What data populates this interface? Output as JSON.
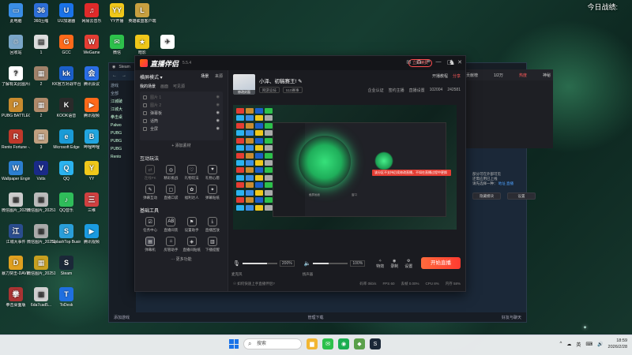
{
  "desktop": {
    "top_right_text": "今日战绩:",
    "col1": [
      {
        "label": "此电脑",
        "color": "#3a8ee6",
        "glyph": "▭"
      },
      {
        "label": "回收站",
        "color": "#7aa6c8",
        "glyph": "♲"
      },
      {
        "label": "了解有关此图片的信息",
        "color": "#ffffff",
        "glyph": "?"
      },
      {
        "label": "PUBG BATTLEGR...",
        "color": "#c98b2f",
        "glyph": "P"
      },
      {
        "label": "Rento Fortune -...",
        "color": "#c0392b",
        "glyph": "R"
      },
      {
        "label": "Wallpaper Engine:...",
        "color": "#2c7fd1",
        "glyph": "W"
      },
      {
        "label": "微信图片_2025121...",
        "color": "#cccccc",
        "glyph": "▦"
      },
      {
        "label": "江城大事件",
        "color": "#2a4d8f",
        "glyph": "江"
      },
      {
        "label": "暴力突击-DAVE T...",
        "color": "#e0a020",
        "glyph": "D"
      },
      {
        "label": "拳击桌面版",
        "color": "#aa3333",
        "glyph": "拳"
      }
    ],
    "col2": [
      {
        "label": "360压缩",
        "color": "#2d6fd8",
        "glyph": "36"
      },
      {
        "label": "1",
        "color": "#dddddd",
        "glyph": "▤"
      },
      {
        "label": "2",
        "color": "#a0826a",
        "glyph": "▦"
      },
      {
        "label": "2",
        "color": "#b08a6a",
        "glyph": "▦"
      },
      {
        "label": "3",
        "color": "#c0a080",
        "glyph": "▦"
      },
      {
        "label": "Vstts",
        "color": "#1a2a88",
        "glyph": "V"
      },
      {
        "label": "微信图片_2025121...",
        "color": "#bbbbbb",
        "glyph": "▦"
      },
      {
        "label": "微信图片_2025121...",
        "color": "#aaaaaa",
        "glyph": "▦"
      },
      {
        "label": "微信图片_2025121...",
        "color": "#c8a020",
        "glyph": "▦"
      },
      {
        "label": "6da7cad5...",
        "color": "#d0d0d0",
        "glyph": "▦"
      }
    ],
    "col3": [
      {
        "label": "UU加速器",
        "color": "#1a73e8",
        "glyph": "U"
      },
      {
        "label": "GCC",
        "color": "#ff6a1a",
        "glyph": "G"
      },
      {
        "label": "KK官方对战平台",
        "color": "#1b5fc9",
        "glyph": "kk"
      },
      {
        "label": "KOOK语音",
        "color": "#2a2a2a",
        "glyph": "K"
      },
      {
        "label": "Microsoft Edge",
        "color": "#1a9bd7",
        "glyph": "e"
      },
      {
        "label": "QQ",
        "color": "#2bb3f0",
        "glyph": "Q"
      },
      {
        "label": "QQ音乐",
        "color": "#2fbd5a",
        "glyph": "♪"
      },
      {
        "label": "SplashTop Business",
        "color": "#2a9ed8",
        "glyph": "S"
      },
      {
        "label": "Steam",
        "color": "#1b2838",
        "glyph": "S"
      },
      {
        "label": "ToDesk",
        "color": "#1f6fe0",
        "glyph": "T"
      }
    ],
    "col4": [
      {
        "label": "网易云音乐",
        "color": "#e02a2a",
        "glyph": "♫"
      },
      {
        "label": "WeGame",
        "color": "#e43d33",
        "glyph": "W"
      },
      {
        "label": "腾讯会议",
        "color": "#2a6ee6",
        "glyph": "会"
      },
      {
        "label": "腾讯视频",
        "color": "#ff6a1a",
        "glyph": "▶"
      },
      {
        "label": "哔哩哔哩",
        "color": "#21a5e0",
        "glyph": "B"
      },
      {
        "label": "YY",
        "color": "#f0c81a",
        "glyph": "Y"
      },
      {
        "label": "三维",
        "color": "#d04040",
        "glyph": "三"
      },
      {
        "label": "腾讯视频",
        "color": "#1a9be0",
        "glyph": "▶"
      }
    ],
    "col5": [
      {
        "label": "YY开播",
        "color": "#f0c81a",
        "glyph": "YY"
      },
      {
        "label": "微信",
        "color": "#2dc14b",
        "glyph": "✉"
      },
      {
        "label": "网易",
        "color": "#b02a2a",
        "glyph": "网"
      }
    ],
    "col6": [
      {
        "label": "英雄联盟客户端",
        "color": "#c8a040",
        "glyph": "L"
      },
      {
        "label": "暗影",
        "color": "#f0c81a",
        "glyph": "★"
      }
    ],
    "col7": [
      {
        "label": "",
        "color": "#ffffff",
        "glyph": "✈"
      }
    ]
  },
  "steam": {
    "title": "Steam",
    "nav": [
      "←",
      "→"
    ],
    "side_items": [
      "游戏",
      "全部",
      "江城破",
      "江城大",
      "拳击桌",
      "Palwo",
      "PUBG",
      "PUBG",
      "PUBG",
      "Rento"
    ],
    "bottom_left": "添加游戏",
    "bottom_mid": "管理下载",
    "bottom_right": "好友与聊天",
    "cut_text": "Rento"
  },
  "right_win": {
    "label1": "贡献榜",
    "label2": "1/2万",
    "label3": "热度",
    "label4": "神秘",
    "note_line1": "部分可在外部可见",
    "note_line2": "还需应用已上线",
    "note_line3": "请先选择一种：",
    "note_link1": "地址",
    "note_link2": "直播",
    "btn1": "隐藏模块",
    "btn2": "设置"
  },
  "live": {
    "app_name": "直播伴侣",
    "version": "5.5.4",
    "vip_label": "立即续费",
    "left": {
      "mode": "横屏模式",
      "tab_scene": "场景",
      "tab_source": "来源",
      "scene_tabs": [
        "我的场景",
        "画面",
        "可见源"
      ],
      "scenes": [
        {
          "name": "图片 1",
          "dim": true
        },
        {
          "name": "图片 2",
          "dim": true
        },
        {
          "name": "弹幕板",
          "dim": false
        },
        {
          "name": "话筒",
          "dim": false
        },
        {
          "name": "全屏",
          "dim": false
        }
      ],
      "add_source": "+ 添加素材",
      "section_interact": "互动玩法",
      "interact_tools": [
        {
          "label": "连线PK",
          "glyph": "⇄",
          "dim": true
        },
        {
          "label": "精彩挑战",
          "glyph": "◎",
          "dim": false
        },
        {
          "label": "礼物玩法",
          "glyph": "♡",
          "dim": false
        },
        {
          "label": "礼物心愿",
          "glyph": "♥",
          "dim": false
        },
        {
          "label": "弹幕互动",
          "glyph": "✎",
          "dim": false
        },
        {
          "label": "直播口袋",
          "glyph": "▢",
          "dim": false
        },
        {
          "label": "福利达人",
          "glyph": "✿",
          "dim": false
        },
        {
          "label": "弹幕贴纸",
          "glyph": "✦",
          "dim": false
        }
      ],
      "section_basic": "基础工具",
      "basic_tools": [
        {
          "label": "任务中心",
          "glyph": "☑",
          "active": false
        },
        {
          "label": "直播间装",
          "glyph": "AB",
          "active": false
        },
        {
          "label": "设置助手",
          "glyph": "⚑",
          "active": false
        },
        {
          "label": "直播回放",
          "glyph": "⤓",
          "active": false
        },
        {
          "label": "弹幕机",
          "glyph": "▤",
          "active": true
        },
        {
          "label": "房管助手",
          "glyph": "⌂",
          "active": false
        },
        {
          "label": "直播间贴纸",
          "glyph": "◈",
          "active": false
        },
        {
          "label": "下播提醒",
          "glyph": "▥",
          "active": false
        }
      ],
      "more": "··· 更多功能"
    },
    "room": {
      "thumb_caption": "修改封面",
      "title": "小泽、初稿赛王!",
      "sub_label": "网游竞技",
      "sub_channel": "510赛事",
      "actions": [
        "开播教程",
        "分享"
      ],
      "badges": [
        "企业认证",
        "签约主播",
        "直播设置"
      ],
      "stat1": "102004",
      "stat2": "242581"
    },
    "preview": {
      "toast": "该分区不支持后续修改直播，不如在直播过程中更换",
      "tiny1": "截屏画面",
      "tiny2": "窗口"
    },
    "controls": {
      "mic_label": "麦克风",
      "mic_value": "200%",
      "mic_fill": 0.7,
      "speaker_label": "扬声器",
      "speaker_value": "100%",
      "speaker_fill": 0.45,
      "icons": [
        "特效",
        "录制",
        "设置"
      ],
      "start_label": "开始直播"
    },
    "status": {
      "left": "☉ 如何快速上手直播伴侣?",
      "stats": [
        "码率 0kb/s",
        "FPS 60",
        "丢帧 0.00%",
        "CPU 8%",
        "内存 58%"
      ]
    }
  },
  "taskbar": {
    "search_placeholder": "搜索",
    "apps": [
      {
        "name": "file-explorer",
        "color": "#f2b632",
        "glyph": "▆"
      },
      {
        "name": "wechat",
        "color": "#2dc14b",
        "glyph": "✉"
      },
      {
        "name": "chat",
        "color": "#1aad50",
        "glyph": "◉"
      },
      {
        "name": "maps",
        "color": "#5aa04a",
        "glyph": "◆"
      },
      {
        "name": "steam",
        "color": "#1b2838",
        "glyph": "S"
      }
    ],
    "tray": [
      "^",
      "☁",
      "英",
      "⌨",
      "🔊"
    ],
    "time": "18:59",
    "date": "2026/2/28"
  }
}
